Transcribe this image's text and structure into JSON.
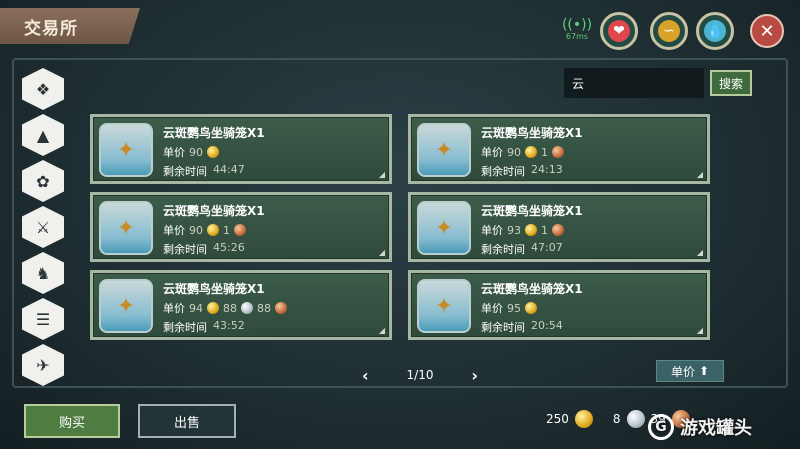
{
  "title": "交易所",
  "network": {
    "latency": "67ms"
  },
  "top_icons": [
    {
      "name": "heart-icon",
      "glyph": "❤",
      "color": "#e0464b"
    },
    {
      "name": "stomach-icon",
      "glyph": "∽",
      "color": "#d9a329"
    },
    {
      "name": "drop-icon",
      "glyph": "💧",
      "color": "#4cb6d2"
    }
  ],
  "close_glyph": "✕",
  "sidebar": {
    "items": [
      {
        "name": "sidebar-item-materials",
        "glyph": "❖"
      },
      {
        "name": "sidebar-item-camp",
        "glyph": "▲"
      },
      {
        "name": "sidebar-item-paw",
        "glyph": "✿"
      },
      {
        "name": "sidebar-item-weapons",
        "glyph": "⚔"
      },
      {
        "name": "sidebar-item-mounts",
        "glyph": "♞"
      },
      {
        "name": "sidebar-item-furniture",
        "glyph": "☰"
      },
      {
        "name": "sidebar-item-misc",
        "glyph": "✈"
      }
    ]
  },
  "search": {
    "value": "云",
    "button_label": "搜索"
  },
  "listings": [
    {
      "name": "云斑鹦鸟坐骑笼X1",
      "price_label": "单价",
      "gold": "90",
      "silver": "",
      "copper": "",
      "time_label": "剩余时间",
      "time": "44:47"
    },
    {
      "name": "云斑鹦鸟坐骑笼X1",
      "price_label": "单价",
      "gold": "90",
      "silver": "",
      "copper": "1",
      "time_label": "剩余时间",
      "time": "24:13"
    },
    {
      "name": "云斑鹦鸟坐骑笼X1",
      "price_label": "单价",
      "gold": "90",
      "silver": "",
      "copper": "1",
      "time_label": "剩余时间",
      "time": "45:26"
    },
    {
      "name": "云斑鹦鸟坐骑笼X1",
      "price_label": "单价",
      "gold": "93",
      "silver": "",
      "copper": "1",
      "time_label": "剩余时间",
      "time": "47:07"
    },
    {
      "name": "云斑鹦鸟坐骑笼X1",
      "price_label": "单价",
      "gold": "94",
      "silver": "88",
      "copper": "88",
      "time_label": "剩余时间",
      "time": "43:52"
    },
    {
      "name": "云斑鹦鸟坐骑笼X1",
      "price_label": "单价",
      "gold": "95",
      "silver": "",
      "copper": "",
      "time_label": "剩余时间",
      "time": "20:54"
    }
  ],
  "pager": {
    "prev": "‹",
    "next": "›",
    "page": "1/10"
  },
  "sort": {
    "label": "单价",
    "glyph": "⬆"
  },
  "buy_label": "购买",
  "sell_label": "出售",
  "wallet": {
    "gold": "250",
    "silver": "8",
    "copper": "39"
  },
  "watermark": {
    "glyph": "G",
    "text": "游戏罐头"
  }
}
